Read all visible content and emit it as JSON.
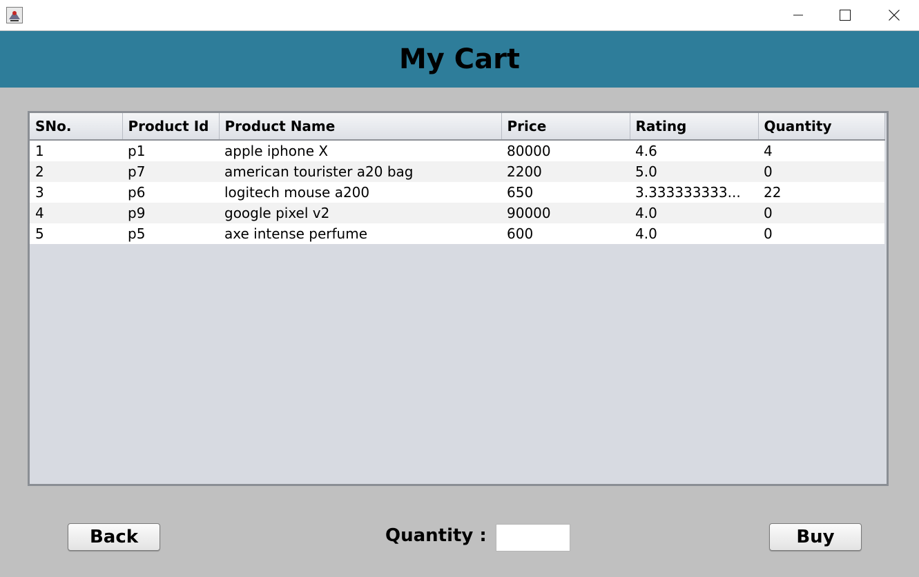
{
  "header": {
    "title": "My Cart"
  },
  "window_controls": [
    "minimize-icon",
    "maximize-icon",
    "close-icon"
  ],
  "table": {
    "columns": [
      "SNo.",
      "Product Id",
      "Product Name",
      "Price",
      "Rating",
      "Quantity"
    ],
    "rows": [
      [
        "1",
        "p1",
        "apple iphone X",
        "80000",
        "4.6",
        "4"
      ],
      [
        "2",
        "p7",
        "american tourister a20 bag",
        "2200",
        "5.0",
        "0"
      ],
      [
        "3",
        "p6",
        "logitech mouse a200",
        "650",
        "3.333333333...",
        "22"
      ],
      [
        "4",
        "p9",
        "google pixel v2",
        "90000",
        "4.0",
        "0"
      ],
      [
        "5",
        "p5",
        "axe intense perfume",
        "600",
        "4.0",
        "0"
      ]
    ]
  },
  "footer": {
    "back_label": "Back",
    "quantity_label": "Quantity :",
    "quantity_value": "",
    "buy_label": "Buy"
  },
  "colors": {
    "header_bg": "#2e7d9a",
    "body_bg": "#c0c0c0",
    "table_bg": "#d7dae1"
  }
}
